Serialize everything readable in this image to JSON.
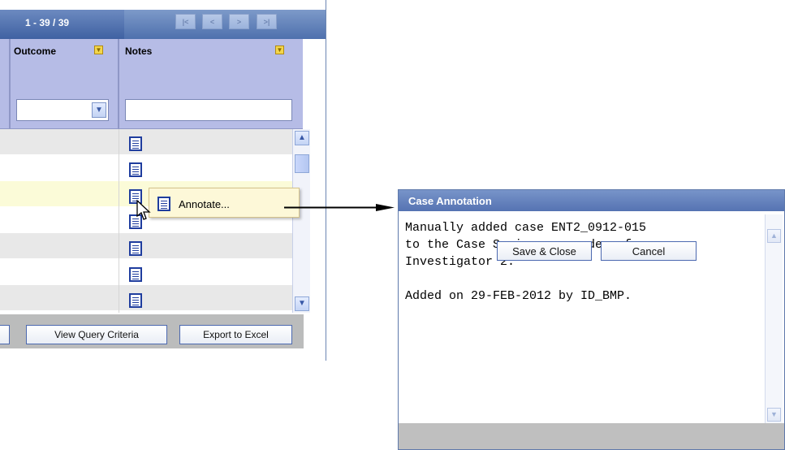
{
  "grid": {
    "pager": {
      "count": "1 - 39 / 39",
      "first": "|<",
      "prev": "<",
      "next": ">",
      "last": ">|"
    },
    "columns": [
      {
        "title": "Outcome",
        "sort_icon": "sort-arrow-icon"
      },
      {
        "title": "Notes",
        "sort_icon": "sort-arrow-icon"
      }
    ],
    "filters": {
      "outcome_value": "",
      "notes_value": ""
    },
    "rows": [
      {
        "note_icon": "note-document-icon",
        "highlighted": false
      },
      {
        "note_icon": "note-document-icon",
        "highlighted": false
      },
      {
        "note_icon": "note-document-icon",
        "highlighted": true
      },
      {
        "note_icon": "note-document-icon",
        "highlighted": false
      },
      {
        "note_icon": "note-document-icon",
        "highlighted": false
      },
      {
        "note_icon": "note-document-icon",
        "highlighted": false
      },
      {
        "note_icon": "note-document-icon",
        "highlighted": false
      }
    ],
    "footer": {
      "view_query_label": "View Query Criteria",
      "export_label": "Export to Excel"
    }
  },
  "context_menu": {
    "annotate_label": "Annotate..."
  },
  "annotation_dialog": {
    "title": "Case Annotation",
    "text": "Manually added case ENT2_0912-015\nto the Case Series per order of\nInvestigator 2.\n\nAdded on 29-FEB-2012 by ID_BMP.",
    "save_label": "Save & Close",
    "cancel_label": "Cancel"
  },
  "colors": {
    "header_bg": "#b6bce6",
    "title_bar": "#5573b2",
    "highlight_row": "#fbfbd8",
    "menu_bg": "#fdf8d8"
  }
}
